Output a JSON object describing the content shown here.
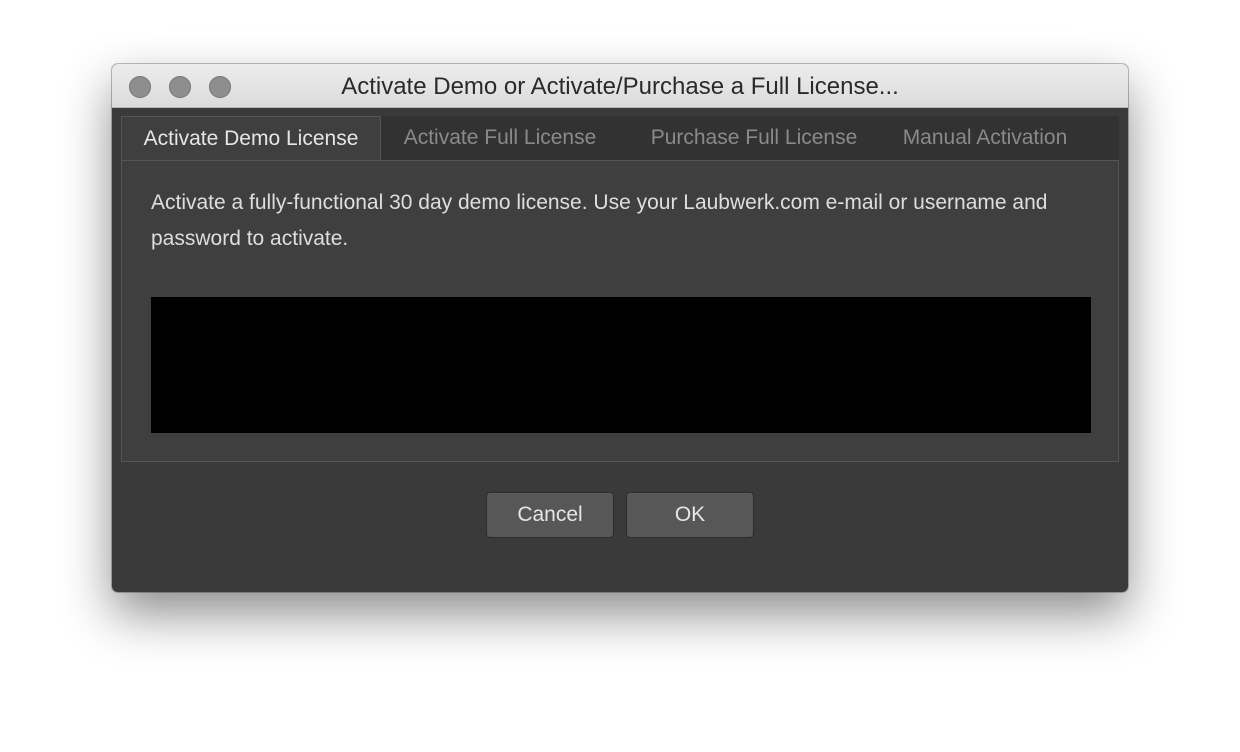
{
  "window": {
    "title": "Activate Demo or Activate/Purchase a Full License..."
  },
  "tabs": [
    {
      "label": "Activate Demo License",
      "active": true
    },
    {
      "label": "Activate Full License",
      "active": false
    },
    {
      "label": "Purchase Full License",
      "active": false
    },
    {
      "label": "Manual Activation",
      "active": false
    }
  ],
  "panel": {
    "description": "Activate a fully-functional 30 day demo license. Use your Laubwerk.com e-mail or username and password to activate."
  },
  "buttons": {
    "cancel_label": "Cancel",
    "ok_label": "OK"
  },
  "colors": {
    "window_bg": "#3a3a3a",
    "panel_bg": "#3f3f3f",
    "button_bg": "#575757",
    "redacted": "#000000"
  }
}
